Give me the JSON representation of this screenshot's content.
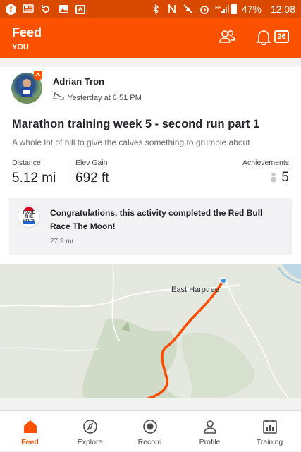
{
  "statusbar": {
    "battery": "47%",
    "time": "12:08"
  },
  "appbar": {
    "title": "Feed",
    "subtitle": "YOU",
    "notification_count": "26",
    "accent": "#fc5200"
  },
  "activity": {
    "athlete_name": "Adrian Tron",
    "timestamp": "Yesterday at 6:51 PM",
    "title": "Marathon training week 5 - second run part 1",
    "description": "A whole lot of hill to give the calves something to grumble about",
    "stats": {
      "distance_label": "Distance",
      "distance_value": "5.12 mi",
      "elev_label": "Elev Gain",
      "elev_value": "692 ft",
      "achievements_label": "Achievements",
      "achievements_value": "5"
    },
    "challenge": {
      "logo_text": "RACE THE MOON",
      "message": "Congratulations, this activity completed the Red Bull Race The Moon!",
      "distance": "27.9 mi"
    },
    "map": {
      "place_label": "East Harptree",
      "route_color": "#fc4c02"
    }
  },
  "tabs": [
    {
      "label": "Feed",
      "icon": "home-icon",
      "active": true
    },
    {
      "label": "Explore",
      "icon": "compass-icon",
      "active": false
    },
    {
      "label": "Record",
      "icon": "record-icon",
      "active": false
    },
    {
      "label": "Profile",
      "icon": "profile-icon",
      "active": false
    },
    {
      "label": "Training",
      "icon": "training-icon",
      "active": false
    }
  ]
}
